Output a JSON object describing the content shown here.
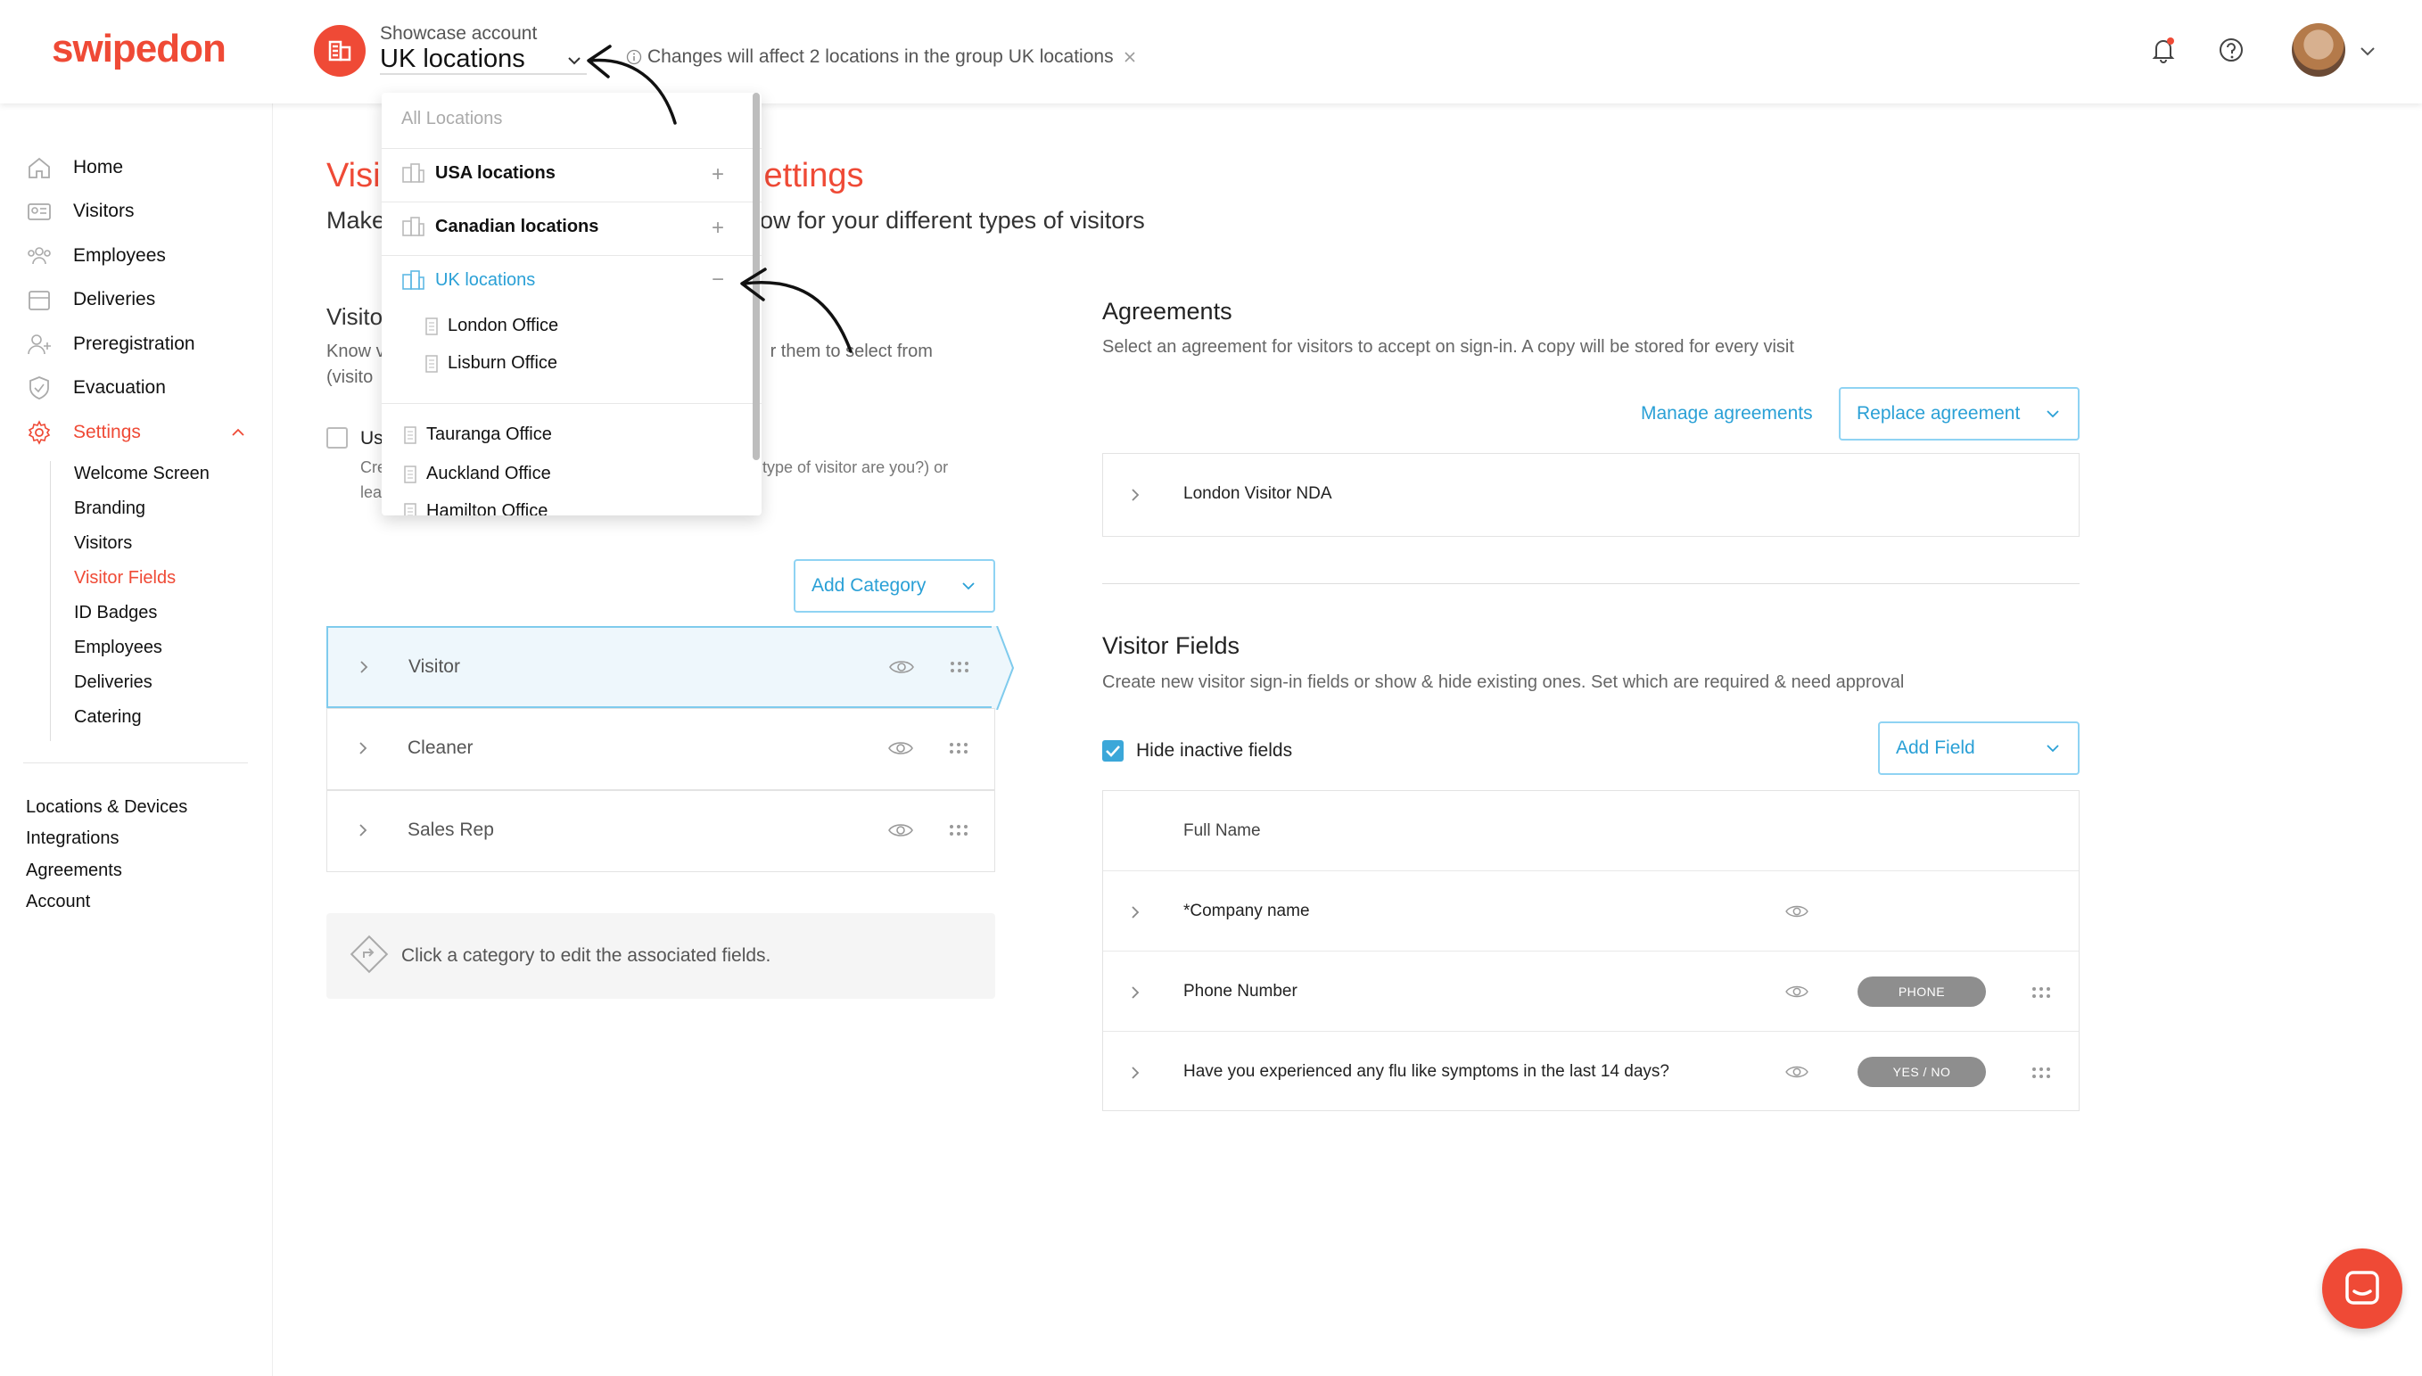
{
  "colors": {
    "brand": "#ef4a36",
    "accent": "#2aa0d6",
    "badge": "#8e8e8e"
  },
  "header": {
    "logo": "swipedon",
    "account_label": "Showcase account",
    "account_name": "UK locations",
    "info": "Changes will affect 2 locations in the group UK locations",
    "icons": [
      "building-icon",
      "info-icon",
      "close-icon",
      "bell-icon",
      "help-icon",
      "avatar",
      "chevron-down-icon"
    ]
  },
  "sidebar": {
    "items": [
      {
        "label": "Home",
        "icon": "home-icon"
      },
      {
        "label": "Visitors",
        "icon": "visitor-card-icon"
      },
      {
        "label": "Employees",
        "icon": "employees-icon"
      },
      {
        "label": "Deliveries",
        "icon": "box-icon"
      },
      {
        "label": "Preregistration",
        "icon": "user-plus-icon"
      },
      {
        "label": "Evacuation",
        "icon": "shield-icon"
      },
      {
        "label": "Settings",
        "icon": "gear-icon"
      }
    ],
    "settings_sub": [
      "Welcome Screen",
      "Branding",
      "Visitors",
      "Visitor Fields",
      "ID Badges",
      "Employees",
      "Deliveries",
      "Catering"
    ],
    "active_sub": "Visitor Fields",
    "bottom": [
      "Locations & Devices",
      "Integrations",
      "Agreements",
      "Account"
    ]
  },
  "dropdown": {
    "all": "All Locations",
    "groups": [
      {
        "label": "USA locations",
        "control": "+"
      },
      {
        "label": "Canadian locations",
        "control": "+"
      },
      {
        "label": "UK locations",
        "control": "−"
      }
    ],
    "uk_children": [
      "London Office",
      "Lisburn Office"
    ],
    "other": [
      "Tauranga Office",
      "Auckland Office",
      "Hamilton Office"
    ]
  },
  "main": {
    "title_visible_left": "Visi",
    "title_visible_right": "ettings",
    "subtitle_visible_left": "Make",
    "subtitle_visible_right": "low for your different types of visitors",
    "section_title": "Visito",
    "section_desc_line1_left": "Know v",
    "section_desc_line1_right": "r them to select from",
    "section_desc_line2": "(visito",
    "use_label": "Us",
    "use_help1_left": "Cre",
    "use_help1_right": "t type of visitor are you?) or",
    "use_help2": "lea",
    "add_category": "Add Category",
    "categories": [
      "Visitor",
      "Cleaner",
      "Sales Rep"
    ],
    "hint": "Click a category to edit the associated fields."
  },
  "agreements": {
    "title": "Agreements",
    "desc": "Select an agreement for visitors to accept on sign-in. A copy will be stored for every visit",
    "manage": "Manage agreements",
    "replace": "Replace agreement",
    "items": [
      "London Visitor NDA"
    ]
  },
  "visitor_fields": {
    "title": "Visitor Fields",
    "desc": "Create new visitor sign-in fields or show & hide existing ones. Set which are required & need approval",
    "hide_inactive": "Hide inactive fields",
    "add_field": "Add Field",
    "rows": [
      {
        "label": "Full Name",
        "badge": ""
      },
      {
        "label": "*Company name",
        "badge": ""
      },
      {
        "label": "Phone Number",
        "badge": "PHONE"
      },
      {
        "label": "Have you experienced any flu like symptoms in the last 14 days?",
        "badge": "YES / NO"
      }
    ]
  }
}
